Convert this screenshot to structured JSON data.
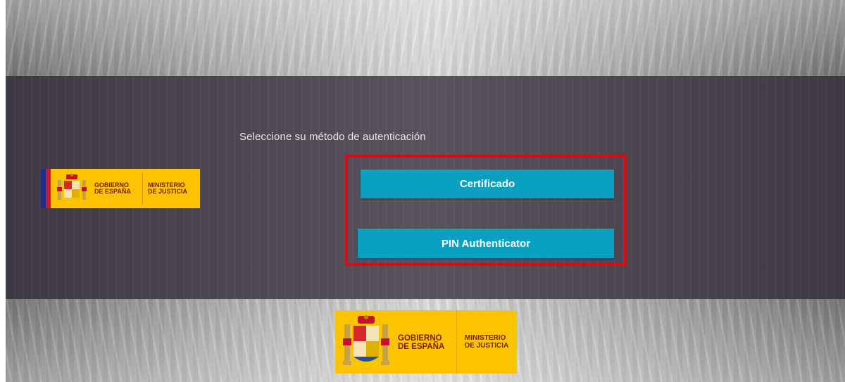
{
  "page": {
    "prompt": "Seleccione su método de autenticación"
  },
  "auth": {
    "certificate_label": "Certificado",
    "pin_label": "PIN Authenticator"
  },
  "branding": {
    "gobierno_line1": "GOBIERNO",
    "gobierno_line2": "DE ESPAÑA",
    "ministerio_line1": "MINISTERIO",
    "ministerio_line2": "DE JUSTICIA"
  },
  "colors": {
    "button": "#0aa0c2",
    "highlight": "#e30613",
    "logo_background": "#fcc400",
    "panel": "#46404b"
  },
  "icons": {
    "coat_of_arms": "spain-coat-of-arms-icon"
  }
}
